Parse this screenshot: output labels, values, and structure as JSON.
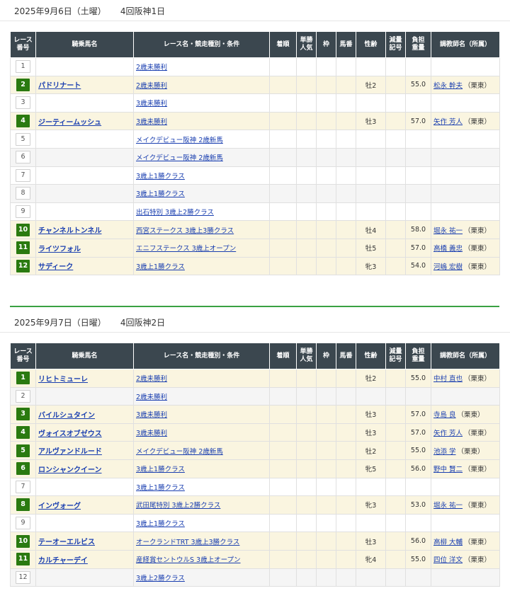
{
  "columns": [
    "レース\n番号",
    "騎乗馬名",
    "レース名・競走種別・条件",
    "着順",
    "単勝\n人気",
    "枠",
    "馬番",
    "性齢",
    "減量\n記号",
    "負担\n重量",
    "調教師名（所属）"
  ],
  "days": [
    {
      "date": "2025年9月6日（土曜）",
      "venue": "4回阪神1日",
      "races": [
        {
          "no": "1",
          "horse": "",
          "race": "2歳未勝利",
          "sex_age": "",
          "weight": "",
          "trainer": "",
          "stable": ""
        },
        {
          "no": "2",
          "horse": "パドリナート",
          "race": "2歳未勝利",
          "sex_age": "牡2",
          "weight": "55.0",
          "trainer": "松永 幹夫",
          "stable": "（栗東）"
        },
        {
          "no": "3",
          "horse": "",
          "race": "3歳未勝利",
          "sex_age": "",
          "weight": "",
          "trainer": "",
          "stable": ""
        },
        {
          "no": "4",
          "horse": "ジーティームッシュ",
          "race": "3歳未勝利",
          "sex_age": "牡3",
          "weight": "57.0",
          "trainer": "矢作 芳人",
          "stable": "（栗東）"
        },
        {
          "no": "5",
          "horse": "",
          "race": "メイクデビュー阪神 2歳新馬",
          "sex_age": "",
          "weight": "",
          "trainer": "",
          "stable": ""
        },
        {
          "no": "6",
          "horse": "",
          "race": "メイクデビュー阪神 2歳新馬",
          "sex_age": "",
          "weight": "",
          "trainer": "",
          "stable": ""
        },
        {
          "no": "7",
          "horse": "",
          "race": "3歳上1勝クラス",
          "sex_age": "",
          "weight": "",
          "trainer": "",
          "stable": ""
        },
        {
          "no": "8",
          "horse": "",
          "race": "3歳上1勝クラス",
          "sex_age": "",
          "weight": "",
          "trainer": "",
          "stable": ""
        },
        {
          "no": "9",
          "horse": "",
          "race": "出石特別 3歳上2勝クラス",
          "sex_age": "",
          "weight": "",
          "trainer": "",
          "stable": ""
        },
        {
          "no": "10",
          "horse": "チャンネルトンネル",
          "race": "西宮ステークス 3歳上3勝クラス",
          "sex_age": "牡4",
          "weight": "58.0",
          "trainer": "堀永 祐一",
          "stable": "（栗東）"
        },
        {
          "no": "11",
          "horse": "ライツフォル",
          "race": "エニフステークス 3歳上オープン",
          "sex_age": "牡5",
          "weight": "57.0",
          "trainer": "高橋 義忠",
          "stable": "（栗東）"
        },
        {
          "no": "12",
          "horse": "サディーク",
          "race": "3歳上1勝クラス",
          "sex_age": "牝3",
          "weight": "54.0",
          "trainer": "河嶋 宏樹",
          "stable": "（栗東）"
        }
      ]
    },
    {
      "date": "2025年9月7日（日曜）",
      "venue": "4回阪神2日",
      "races": [
        {
          "no": "1",
          "horse": "リヒトミューレ",
          "race": "2歳未勝利",
          "sex_age": "牡2",
          "weight": "55.0",
          "trainer": "中村 直也",
          "stable": "（栗東）"
        },
        {
          "no": "2",
          "horse": "",
          "race": "2歳未勝利",
          "sex_age": "",
          "weight": "",
          "trainer": "",
          "stable": ""
        },
        {
          "no": "3",
          "horse": "バイルシュタイン",
          "race": "3歳未勝利",
          "sex_age": "牡3",
          "weight": "57.0",
          "trainer": "寺島 良",
          "stable": "（栗東）"
        },
        {
          "no": "4",
          "horse": "ヴォイスオブゼウス",
          "race": "3歳未勝利",
          "sex_age": "牡3",
          "weight": "57.0",
          "trainer": "矢作 芳人",
          "stable": "（栗東）"
        },
        {
          "no": "5",
          "horse": "アルヴァンドルード",
          "race": "メイクデビュー阪神 2歳新馬",
          "sex_age": "牡2",
          "weight": "55.0",
          "trainer": "池添 学",
          "stable": "（栗東）"
        },
        {
          "no": "6",
          "horse": "ロンシャンクイーン",
          "race": "3歳上1勝クラス",
          "sex_age": "牝5",
          "weight": "56.0",
          "trainer": "野中 賢二",
          "stable": "（栗東）"
        },
        {
          "no": "7",
          "horse": "",
          "race": "3歳上1勝クラス",
          "sex_age": "",
          "weight": "",
          "trainer": "",
          "stable": ""
        },
        {
          "no": "8",
          "horse": "インヴォーグ",
          "race": "武田尾特別 3歳上2勝クラス",
          "sex_age": "牝3",
          "weight": "53.0",
          "trainer": "堀永 祐一",
          "stable": "（栗東）"
        },
        {
          "no": "9",
          "horse": "",
          "race": "3歳上1勝クラス",
          "sex_age": "",
          "weight": "",
          "trainer": "",
          "stable": ""
        },
        {
          "no": "10",
          "horse": "テーオーエルビス",
          "race": "オークランドTRT 3歳上3勝クラス",
          "sex_age": "牡3",
          "weight": "56.0",
          "trainer": "高柳 大輔",
          "stable": "（栗東）"
        },
        {
          "no": "11",
          "horse": "カルチャーデイ",
          "race": "産経賞セントウルS 3歳上オープン",
          "sex_age": "牝4",
          "weight": "55.0",
          "trainer": "四位 洋文",
          "stable": "（栗東）"
        },
        {
          "no": "12",
          "horse": "",
          "race": "3歳上2勝クラス",
          "sex_age": "",
          "weight": "",
          "trainer": "",
          "stable": ""
        }
      ]
    }
  ]
}
